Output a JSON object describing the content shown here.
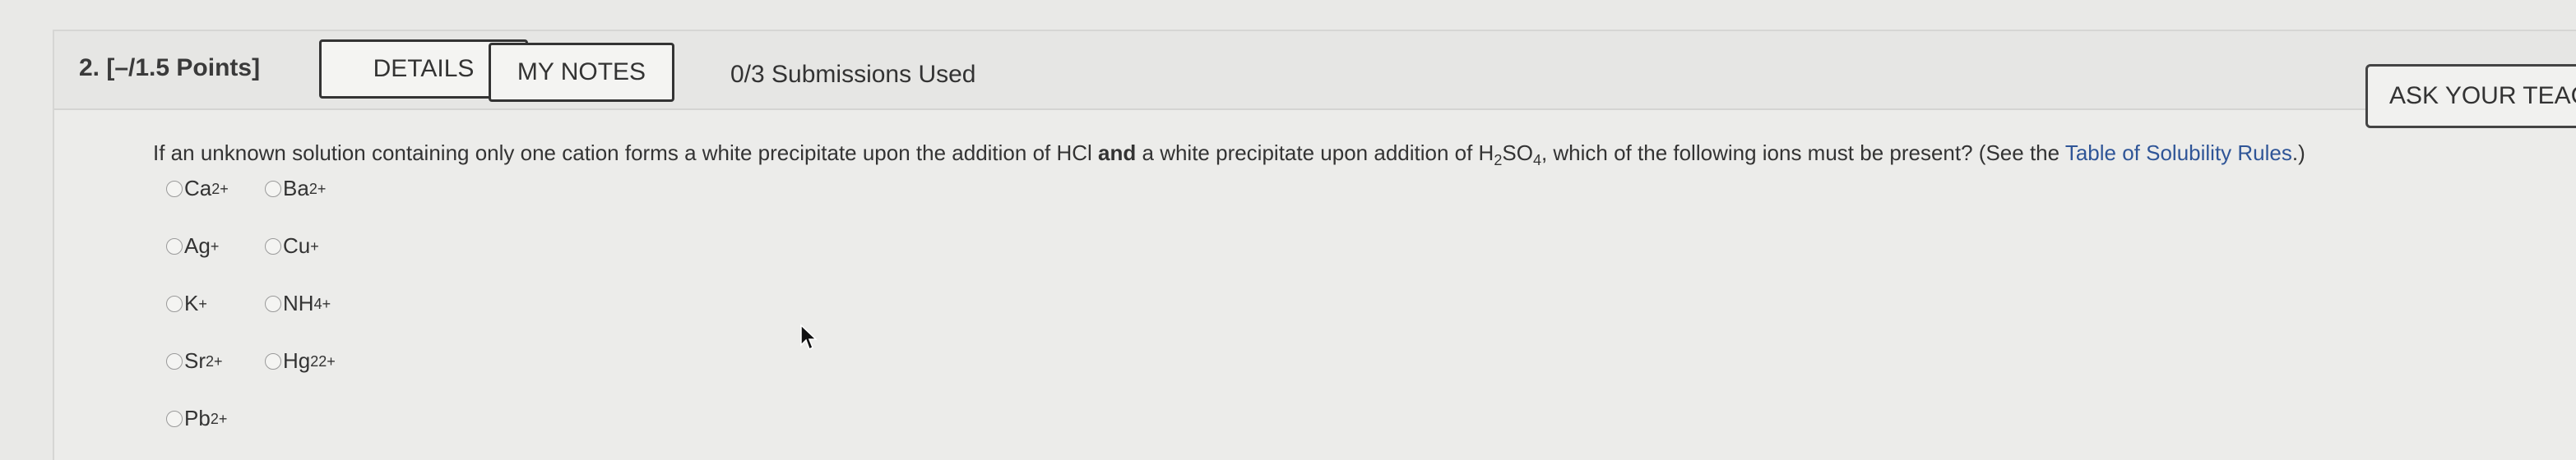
{
  "question": {
    "number_points": "2.  [–/1.5 Points]",
    "submissions": "0/3 Submissions Used",
    "text_part1": "If an unknown solution containing only one cation forms a white precipitate upon the addition of HCl ",
    "text_bold": "and",
    "text_part2": " a white precipitate upon addition of H",
    "text_sub1": "2",
    "text_part3": "SO",
    "text_sub2": "4",
    "text_part4": ", which of the following ions must be present? (See the ",
    "table_link": "Table of Solubility Rules",
    "text_part5": ".)"
  },
  "buttons": {
    "details": "DETAILS",
    "my_notes": "MY NOTES",
    "ask_teacher": "ASK YOUR TEACHER"
  },
  "options": [
    {
      "base": "Ca",
      "sub": "",
      "sup": "2+"
    },
    {
      "base": "Ba",
      "sub": "",
      "sup": "2+"
    },
    {
      "base": "Ag",
      "sub": "",
      "sup": "+"
    },
    {
      "base": "Cu",
      "sub": "",
      "sup": "+"
    },
    {
      "base": "K",
      "sub": "",
      "sup": "+"
    },
    {
      "base": "NH",
      "sub": "4",
      "sup": "+"
    },
    {
      "base": "Sr",
      "sub": "",
      "sup": "2+"
    },
    {
      "base": "Hg",
      "sub": "2",
      "sup": "2+"
    },
    {
      "base": "Pb",
      "sub": "",
      "sup": "2+"
    }
  ],
  "colors": {
    "background": "#e9e9e7",
    "link": "#2f5597",
    "button_border": "#333333"
  }
}
